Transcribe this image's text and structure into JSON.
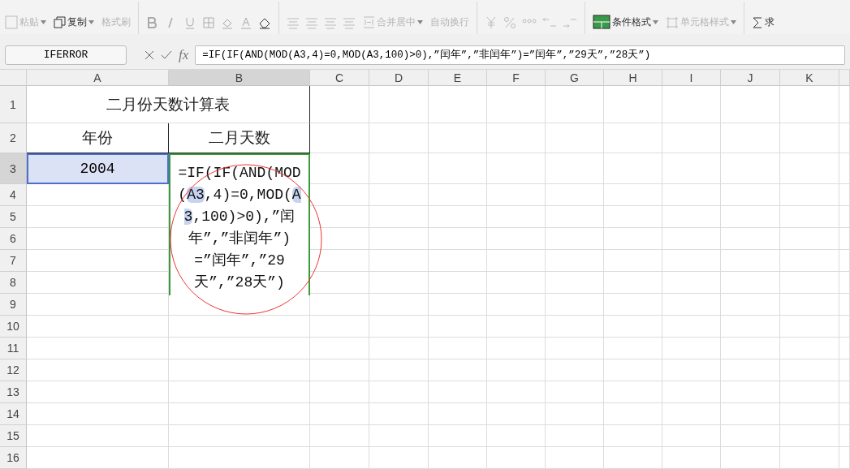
{
  "ribbon": {
    "buttons": [
      {
        "label": "粘贴",
        "disabled": true,
        "dropdown": true
      },
      {
        "label": "复制",
        "disabled": false,
        "dropdown": true
      },
      {
        "label": "格式刷",
        "disabled": true,
        "dropdown": false
      },
      {
        "label": "合并居中",
        "disabled": true,
        "dropdown": true
      },
      {
        "label": "自动换行",
        "disabled": true,
        "dropdown": false
      },
      {
        "label": "条件格式",
        "disabled": false,
        "dropdown": true
      },
      {
        "label": "单元格样式",
        "disabled": true,
        "dropdown": true
      },
      {
        "label": "求",
        "disabled": false,
        "dropdown": false
      }
    ]
  },
  "formula_bar": {
    "name_box": "IFERROR",
    "fx_label": "fx",
    "formula": "=IF(IF(AND(MOD(A3,4)=0,MOD(A3,100)>0),”闰年”,”非闰年”)=”闰年”,”29天”,”28天”)"
  },
  "sheet": {
    "columns": [
      "A",
      "B",
      "C",
      "D",
      "E",
      "F",
      "G",
      "H",
      "I",
      "J",
      "K"
    ],
    "rows": [
      "1",
      "2",
      "3",
      "4",
      "5",
      "6",
      "7",
      "8",
      "9",
      "10",
      "11",
      "12",
      "13",
      "14",
      "15",
      "16"
    ],
    "title": "二月份天数计算表",
    "headers": [
      "年份",
      "二月天数"
    ],
    "year_cell": {
      "value": "2004",
      "selected": true
    },
    "editing_cell": {
      "segments": [
        {
          "kind": "text",
          "text": "=IF(IF(AND(MOD("
        },
        {
          "kind": "ref",
          "text": "A3"
        },
        {
          "kind": "text",
          "text": ",4)=0,MOD("
        },
        {
          "kind": "ref",
          "text": "A3"
        },
        {
          "kind": "text",
          "text": ",100)>0),”闰年”,”非闰年”)=”闰年”,”29天”,”28天”)"
        }
      ]
    }
  }
}
